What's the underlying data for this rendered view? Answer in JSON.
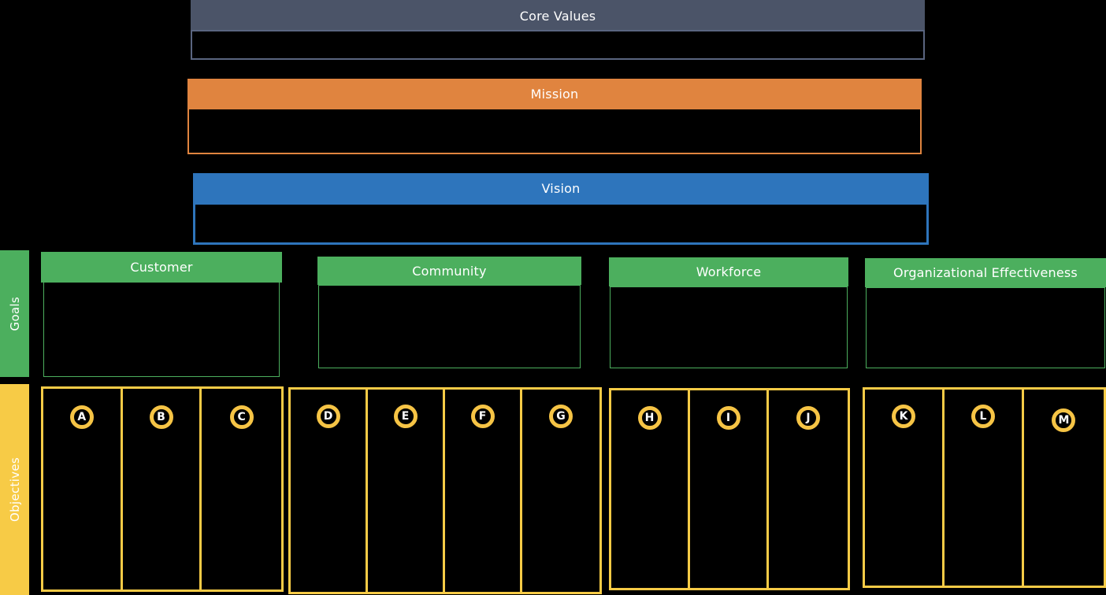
{
  "colors": {
    "core_values": "#4B5468",
    "core_values_border": "#5A6580",
    "mission": "#E0843F",
    "mission_border": "#E0843F",
    "vision": "#2E75BC",
    "vision_border": "#2E75BC",
    "goals_green": "#4CAF5E",
    "objectives_yellow": "#F7CB46",
    "badge_ring": "#F6C445",
    "background": "#000000",
    "text": "#FFFFFF"
  },
  "top_panels": [
    {
      "id": "core-values",
      "title": "Core Values",
      "body": ""
    },
    {
      "id": "mission",
      "title": "Mission",
      "body": ""
    },
    {
      "id": "vision",
      "title": "Vision",
      "body": ""
    }
  ],
  "rows": {
    "goals": {
      "label": "Goals"
    },
    "objectives": {
      "label": "Objectives"
    }
  },
  "goals": [
    {
      "id": "customer",
      "title": "Customer",
      "body": ""
    },
    {
      "id": "community",
      "title": "Community",
      "body": ""
    },
    {
      "id": "workforce",
      "title": "Workforce",
      "body": ""
    },
    {
      "id": "organizational-effectiveness",
      "title": "Organizational Effectiveness",
      "body": ""
    }
  ],
  "objective_groups": [
    {
      "id": "group-customer",
      "goal": "Customer",
      "objectives": [
        {
          "letter": "A",
          "text": ""
        },
        {
          "letter": "B",
          "text": ""
        },
        {
          "letter": "C",
          "text": ""
        }
      ]
    },
    {
      "id": "group-community",
      "goal": "Community",
      "objectives": [
        {
          "letter": "D",
          "text": ""
        },
        {
          "letter": "E",
          "text": ""
        },
        {
          "letter": "F",
          "text": ""
        },
        {
          "letter": "G",
          "text": ""
        }
      ]
    },
    {
      "id": "group-workforce",
      "goal": "Workforce",
      "objectives": [
        {
          "letter": "H",
          "text": ""
        },
        {
          "letter": "I",
          "text": ""
        },
        {
          "letter": "J",
          "text": ""
        }
      ]
    },
    {
      "id": "group-organizational-effectiveness",
      "goal": "Organizational Effectiveness",
      "objectives": [
        {
          "letter": "K",
          "text": ""
        },
        {
          "letter": "L",
          "text": ""
        },
        {
          "letter": "M",
          "text": ""
        }
      ]
    }
  ]
}
